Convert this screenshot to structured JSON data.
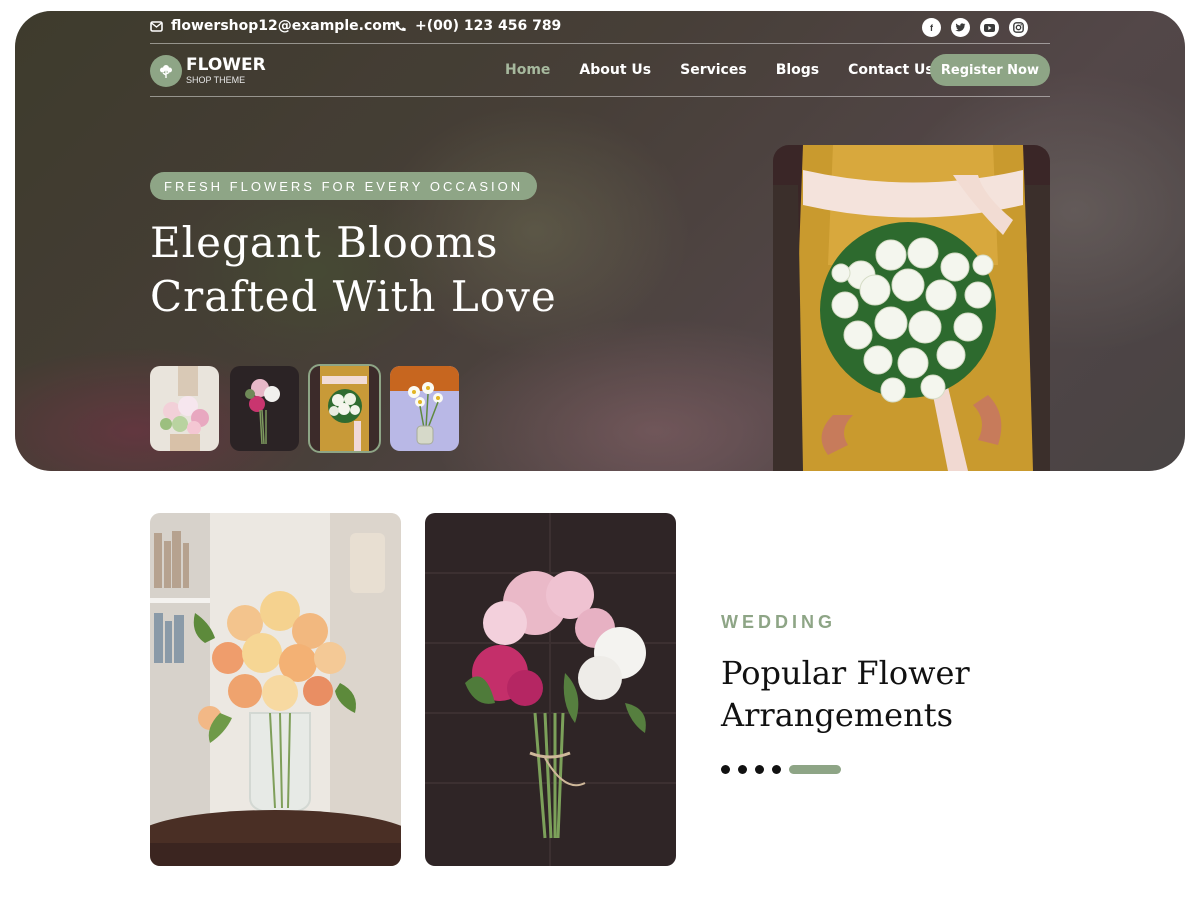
{
  "topbar": {
    "email": "flowershop12@example.com",
    "phone": "+(00) 123 456 789",
    "socials": [
      "facebook-icon",
      "twitter-icon",
      "youtube-icon",
      "instagram-icon"
    ]
  },
  "logo": {
    "title": "FLOWER",
    "subtitle": "SHOP THEME"
  },
  "nav": {
    "items": [
      {
        "label": "Home",
        "active": true
      },
      {
        "label": "About Us"
      },
      {
        "label": "Services"
      },
      {
        "label": "Blogs"
      },
      {
        "label": "Contact Us"
      }
    ],
    "cta": "Register Now"
  },
  "hero": {
    "tagline": "FRESH FLOWERS FOR EVERY OCCASION",
    "title": "Elegant Blooms Crafted With Love",
    "thumbnails": [
      "pastel-bouquet",
      "dark-peony-bouquet",
      "white-rose-bouquet",
      "daisy-jar"
    ],
    "selected_thumbnail": 2
  },
  "section": {
    "eyebrow": "WEDDING",
    "title": "Popular Flower Arrangements",
    "slider_total": 5,
    "slider_active": 4
  },
  "colors": {
    "accent": "#8ea586",
    "dark": "#111111",
    "white": "#ffffff"
  }
}
